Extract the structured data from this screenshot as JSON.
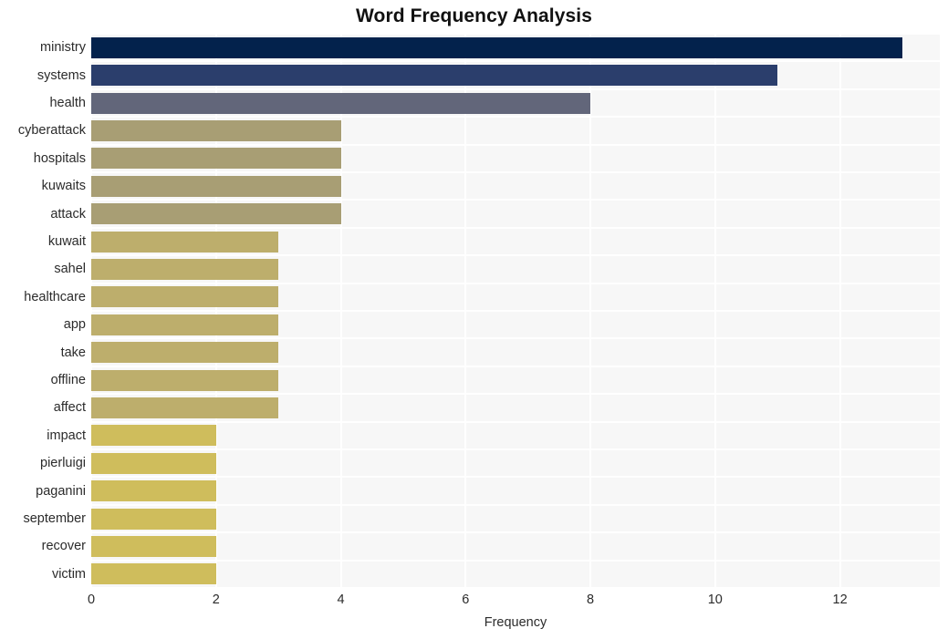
{
  "chart_data": {
    "type": "bar",
    "orientation": "horizontal",
    "title": "Word Frequency Analysis",
    "xlabel": "Frequency",
    "ylabel": "",
    "categories": [
      "ministry",
      "systems",
      "health",
      "cyberattack",
      "hospitals",
      "kuwaits",
      "attack",
      "kuwait",
      "sahel",
      "healthcare",
      "app",
      "take",
      "offline",
      "affect",
      "impact",
      "pierluigi",
      "paganini",
      "september",
      "recover",
      "victim"
    ],
    "values": [
      13,
      11,
      8,
      4,
      4,
      4,
      4,
      3,
      3,
      3,
      3,
      3,
      3,
      3,
      2,
      2,
      2,
      2,
      2,
      2
    ],
    "bar_colors": [
      "#03224c",
      "#2b3e6c",
      "#62667a",
      "#a89e74",
      "#a89e74",
      "#a89e74",
      "#a89e74",
      "#bdae6c",
      "#bdae6c",
      "#bdae6c",
      "#bdae6c",
      "#bdae6c",
      "#bdae6c",
      "#bdae6c",
      "#cfbd5c",
      "#cfbd5c",
      "#cfbd5c",
      "#cfbd5c",
      "#cfbd5c",
      "#cfbd5c"
    ],
    "xlim": [
      0,
      13.6
    ],
    "xticks": [
      0,
      2,
      4,
      6,
      8,
      10,
      12
    ],
    "xtick_labels": [
      "0",
      "2",
      "4",
      "6",
      "8",
      "10",
      "12"
    ],
    "grid": true,
    "grid_color": "#ffffff",
    "plot_background": "#f7f7f7",
    "figure_background": "#ffffff",
    "legend": null
  }
}
